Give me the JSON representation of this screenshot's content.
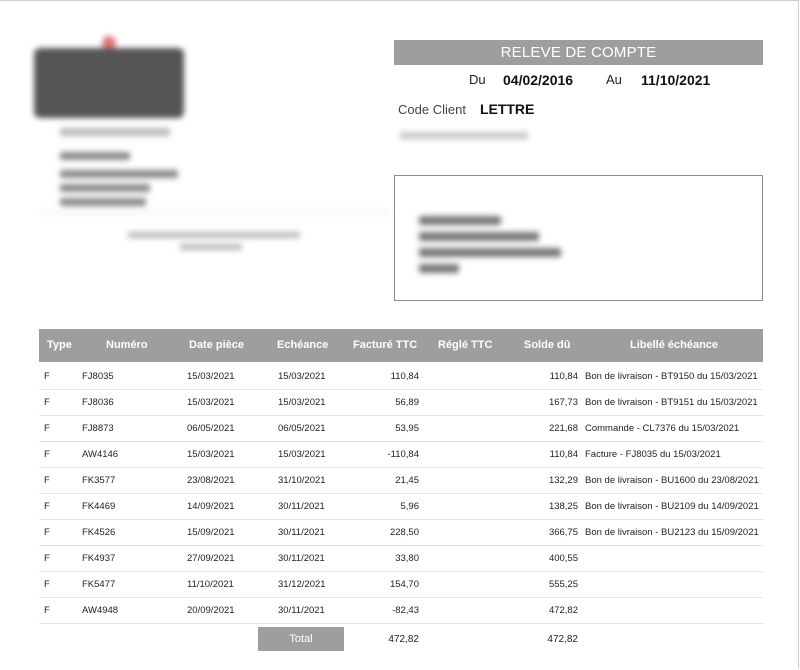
{
  "statement": {
    "title": "RELEVE DE COMPTE",
    "from_label": "Du",
    "from_date": "04/02/2016",
    "to_label": "Au",
    "to_date": "11/10/2021",
    "client_label": "Code Client",
    "client_code": "LETTRE"
  },
  "table": {
    "headers": [
      "Type",
      "Numéro",
      "Date pièce",
      "Echéance",
      "Facturé TTC",
      "Réglé TTC",
      "Solde dû",
      "Libellé échéance"
    ],
    "rows": [
      [
        "F",
        "FJ8035",
        "15/03/2021",
        "15/03/2021",
        "110,84",
        "",
        "110,84",
        "Bon de livraison - BT9150 du 15/03/2021"
      ],
      [
        "F",
        "FJ8036",
        "15/03/2021",
        "15/03/2021",
        "56,89",
        "",
        "167,73",
        "Bon de livraison - BT9151 du 15/03/2021"
      ],
      [
        "F",
        "FJ8873",
        "06/05/2021",
        "06/05/2021",
        "53,95",
        "",
        "221,68",
        "Commande - CL7376 du 15/03/2021"
      ],
      [
        "F",
        "AW4146",
        "15/03/2021",
        "15/03/2021",
        "-110,84",
        "",
        "110,84",
        "Facture - FJ8035 du 15/03/2021"
      ],
      [
        "F",
        "FK3577",
        "23/08/2021",
        "31/10/2021",
        "21,45",
        "",
        "132,29",
        "Bon de livraison - BU1600 du 23/08/2021"
      ],
      [
        "F",
        "FK4469",
        "14/09/2021",
        "30/11/2021",
        "5,96",
        "",
        "138,25",
        "Bon de livraison - BU2109 du 14/09/2021"
      ],
      [
        "F",
        "FK4526",
        "15/09/2021",
        "30/11/2021",
        "228,50",
        "",
        "366,75",
        "Bon de livraison - BU2123 du 15/09/2021"
      ],
      [
        "F",
        "FK4937",
        "27/09/2021",
        "30/11/2021",
        "33,80",
        "",
        "400,55",
        ""
      ],
      [
        "F",
        "FK5477",
        "11/10/2021",
        "31/12/2021",
        "154,70",
        "",
        "555,25",
        ""
      ],
      [
        "F",
        "AW4948",
        "20/09/2021",
        "30/11/2021",
        "-82,43",
        "",
        "472,82",
        ""
      ]
    ],
    "total_label": "Total",
    "total_invoiced": "472,82",
    "total_balance": "472,82"
  }
}
